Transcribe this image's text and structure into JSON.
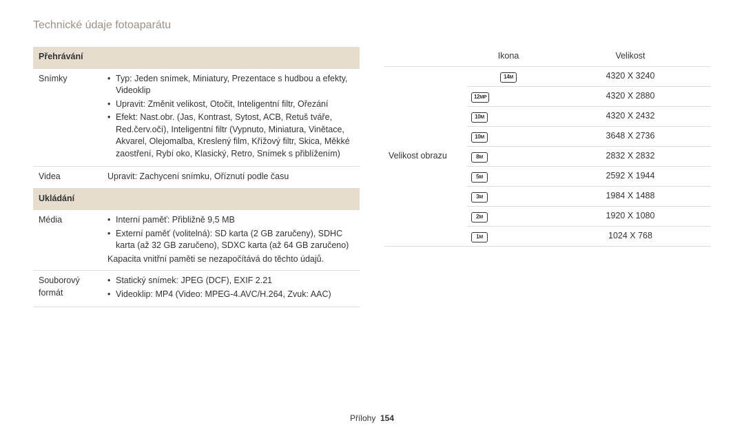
{
  "page_title": "Technické údaje fotoaparátu",
  "left": {
    "section1": "Přehrávání",
    "row1_label": "Snímky",
    "row1_b1": "Typ: Jeden snímek, Miniatury, Prezentace s hudbou a efekty, Videoklip",
    "row1_b2": "Upravit: Změnit velikost, Otočit, Inteligentní filtr, Ořezání",
    "row1_b3": "Efekt: Nast.obr. (Jas, Kontrast, Sytost, ACB, Retuš tváře, Red.červ.očí), Inteligentní filtr (Vypnuto, Miniatura, Vinětace, Akvarel, Olejomalba, Kreslený film, Křížový filtr, Skica, Měkké zaostření, Rybí oko, Klasický, Retro, Snímek s přiblížením)",
    "row2_label": "Videa",
    "row2_val": "Upravit: Zachycení snímku, Oříznutí podle času",
    "section2": "Ukládání",
    "row3_label": "Média",
    "row3_b1": "Interní paměť: Přibližně 9,5 MB",
    "row3_b2": "Externí paměť (volitelná): SD karta (2 GB zaručeny), SDHC karta (až 32 GB zaručeno), SDXC karta (až 64 GB zaručeno)",
    "row3_note": "Kapacita vnitřní paměti se nezapočítává do těchto údajů.",
    "row4_label": "Souborový formát",
    "row4_b1": "Statický snímek: JPEG (DCF), EXIF 2.21",
    "row4_b2": "Videoklip: MP4 (Video: MPEG-4.AVC/H.264, Zvuk: AAC)"
  },
  "right": {
    "row_label": "Velikost obrazu",
    "col_icon": "Ikona",
    "col_size": "Velikost",
    "rows": [
      {
        "icon_main": "14",
        "icon_sub": "M",
        "size": "4320 X 3240"
      },
      {
        "icon_main": "12",
        "icon_sub": "MP",
        "size": "4320 X 2880"
      },
      {
        "icon_main": "10",
        "icon_sub": "M",
        "size": "4320 X 2432"
      },
      {
        "icon_main": "10",
        "icon_sub": "M",
        "size": "3648 X 2736"
      },
      {
        "icon_main": "8",
        "icon_sub": "M",
        "size": "2832 X 2832"
      },
      {
        "icon_main": "5",
        "icon_sub": "M",
        "size": "2592 X 1944"
      },
      {
        "icon_main": "3",
        "icon_sub": "M",
        "size": "1984 X 1488"
      },
      {
        "icon_main": "2",
        "icon_sub": "M",
        "size": "1920 X 1080"
      },
      {
        "icon_main": "1",
        "icon_sub": "M",
        "size": "1024 X 768"
      }
    ]
  },
  "footer": {
    "section": "Přílohy",
    "page": "154"
  }
}
